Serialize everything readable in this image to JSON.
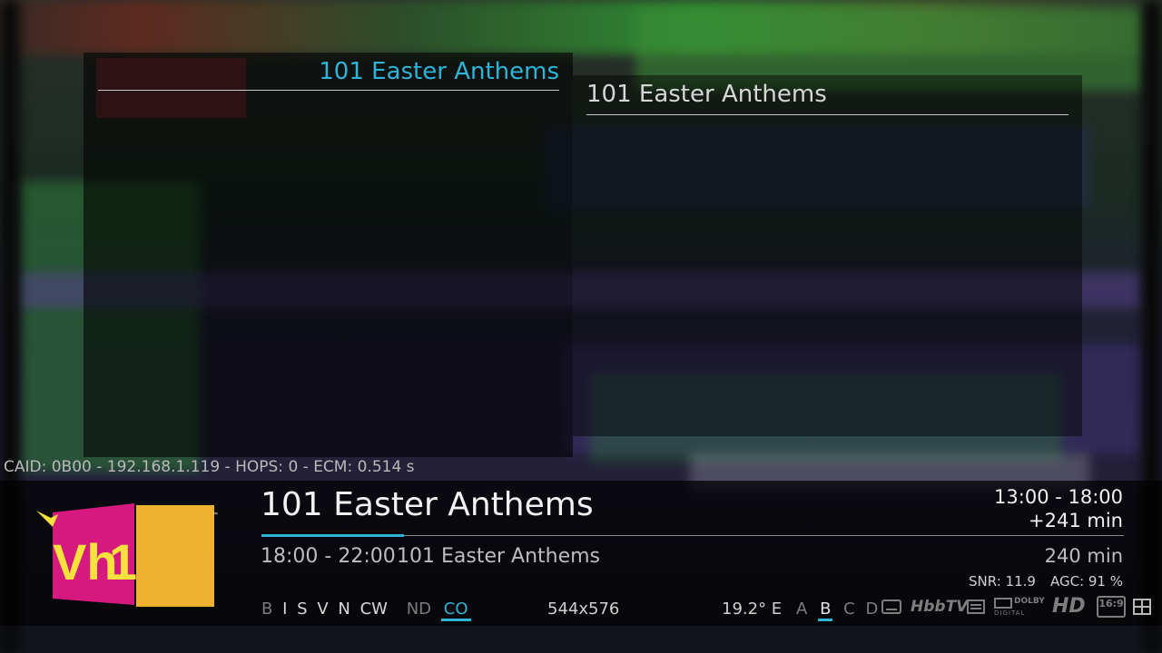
{
  "background": {
    "description_icon": "video-frame"
  },
  "epg_panel_left": {
    "title": "101 Easter Anthems"
  },
  "epg_panel_right": {
    "title": "101 Easter Anthems"
  },
  "caid_line": "CAID: 0B00 - 192.168.1.119 - HOPS: 0 - ECM: 0.514 s",
  "infobar": {
    "channel_logo": "VH1",
    "now": {
      "title": "101 Easter Anthems",
      "time": "13:00 - 18:00",
      "remaining": "+241 min",
      "progress": 0.165
    },
    "next": {
      "time": "18:00  - 22:00",
      "title": "101 Easter Anthems",
      "duration": "240 min"
    },
    "signal": {
      "snr": "SNR: 11.9",
      "agc": "AGC: 91 %"
    },
    "caids": [
      {
        "label": "B",
        "state": "dim"
      },
      {
        "label": "I",
        "state": "lit"
      },
      {
        "label": "S",
        "state": "lit"
      },
      {
        "label": "V",
        "state": "lit"
      },
      {
        "label": "N",
        "state": "lit"
      },
      {
        "label": "CW",
        "state": "lit"
      },
      {
        "label": "ND",
        "state": "dim"
      },
      {
        "label": "CO",
        "state": "active"
      }
    ],
    "resolution": "544x576",
    "orbital": "19.2° E",
    "tuners": [
      {
        "label": "A",
        "active": false
      },
      {
        "label": "B",
        "active": true
      },
      {
        "label": "C",
        "active": false
      },
      {
        "label": "D",
        "active": false
      }
    ],
    "icons": {
      "subtitle": "subtitle-icon",
      "hbbtv": "HbbTV",
      "teletext": "teletext-icon",
      "dolby_top": "DOLBY",
      "dolby_bottom": "DIGITAL",
      "hd": "HD",
      "aspect": "16:9",
      "crypt": "crypt-icon"
    }
  },
  "colors": {
    "accent": "#2fb3d6",
    "logo_pink": "#d6197f",
    "logo_orange": "#f0b030",
    "logo_yellow": "#f5e23c"
  }
}
